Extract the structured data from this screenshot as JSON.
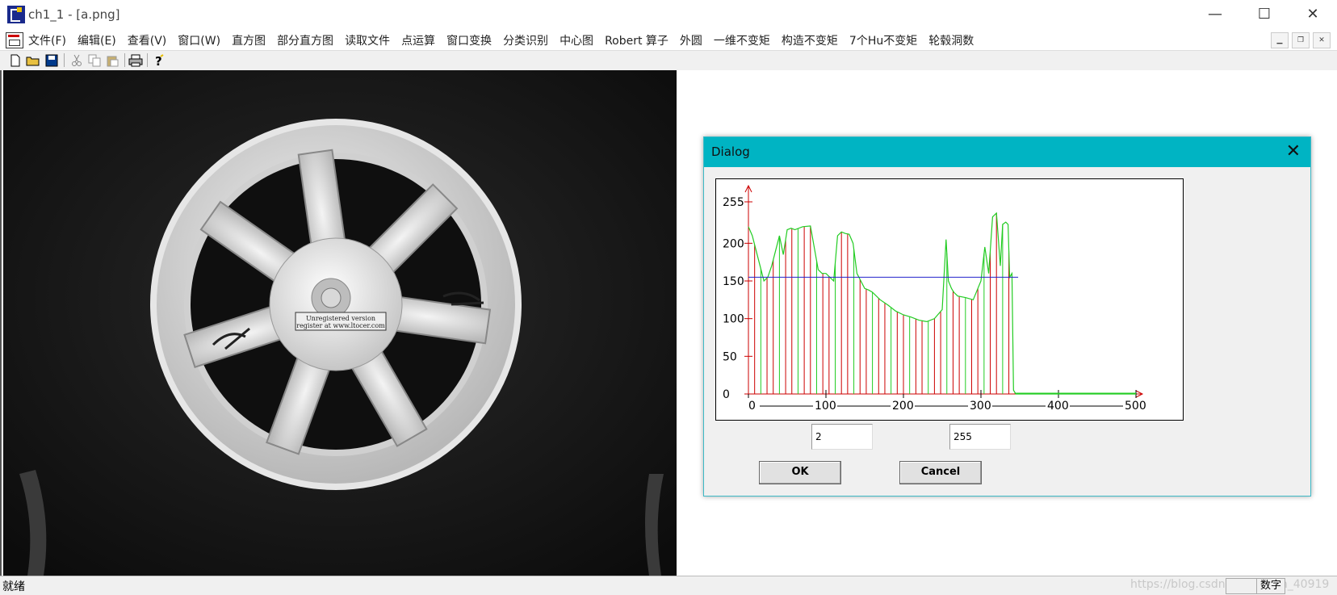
{
  "window": {
    "title": "ch1_1 - [a.png]",
    "minimize": "—",
    "maximize": "☐",
    "close": "✕"
  },
  "menu": {
    "items": [
      "文件(F)",
      "编辑(E)",
      "查看(V)",
      "窗口(W)",
      "直方图",
      "部分直方图",
      "读取文件",
      "点运算",
      "窗口变换",
      "分类识别",
      "中心图",
      "Robert 算子",
      "外圆",
      "一维不变矩",
      "构造不变矩",
      "7个Hu不变矩",
      "轮毂洞数"
    ]
  },
  "mdi": {
    "minimize": "▁",
    "restore": "❐",
    "close": "✕"
  },
  "toolbar": {
    "icons": [
      "new-icon",
      "open-icon",
      "save-icon",
      "cut-icon",
      "copy-icon",
      "paste-icon",
      "print-icon",
      "help-icon"
    ]
  },
  "image": {
    "label_line1": "Unregistered version",
    "label_line2": "register at www.ltocer.com"
  },
  "dialog": {
    "title": "Dialog",
    "close": "✕",
    "field_low": "2",
    "field_high": "255",
    "ok_label": "OK",
    "cancel_label": "Cancel"
  },
  "chart_data": {
    "type": "line",
    "xlim": [
      0,
      500
    ],
    "ylim": [
      0,
      255
    ],
    "xticks": [
      "0",
      "100",
      "200",
      "300",
      "400",
      "500"
    ],
    "yticks": [
      "0",
      "50",
      "100",
      "150",
      "200",
      "255"
    ],
    "threshold": 155,
    "series": [
      {
        "color": "#22cc22",
        "stem_color": "#cc0000",
        "x": [
          0,
          5,
          10,
          15,
          20,
          25,
          30,
          35,
          40,
          45,
          50,
          55,
          60,
          70,
          80,
          90,
          95,
          100,
          110,
          115,
          120,
          125,
          130,
          135,
          140,
          150,
          155,
          160,
          170,
          180,
          190,
          200,
          210,
          220,
          230,
          240,
          250,
          255,
          258,
          262,
          265,
          270,
          280,
          290,
          300,
          305,
          310,
          315,
          320,
          325,
          328,
          332,
          335,
          337,
          340,
          342,
          345,
          350,
          400,
          500
        ],
        "y": [
          222,
          210,
          190,
          170,
          150,
          155,
          170,
          190,
          210,
          185,
          218,
          220,
          218,
          222,
          223,
          165,
          160,
          160,
          150,
          210,
          215,
          213,
          212,
          200,
          160,
          140,
          138,
          135,
          125,
          118,
          110,
          105,
          102,
          98,
          96,
          100,
          112,
          205,
          150,
          140,
          135,
          130,
          128,
          125,
          150,
          195,
          160,
          235,
          240,
          170,
          225,
          228,
          225,
          155,
          160,
          5,
          0,
          0,
          0,
          0
        ]
      }
    ]
  },
  "status": {
    "ready": "就绪",
    "numlock": "数字",
    "watermark": "https://blog.csdn.net/weixin_40919"
  }
}
